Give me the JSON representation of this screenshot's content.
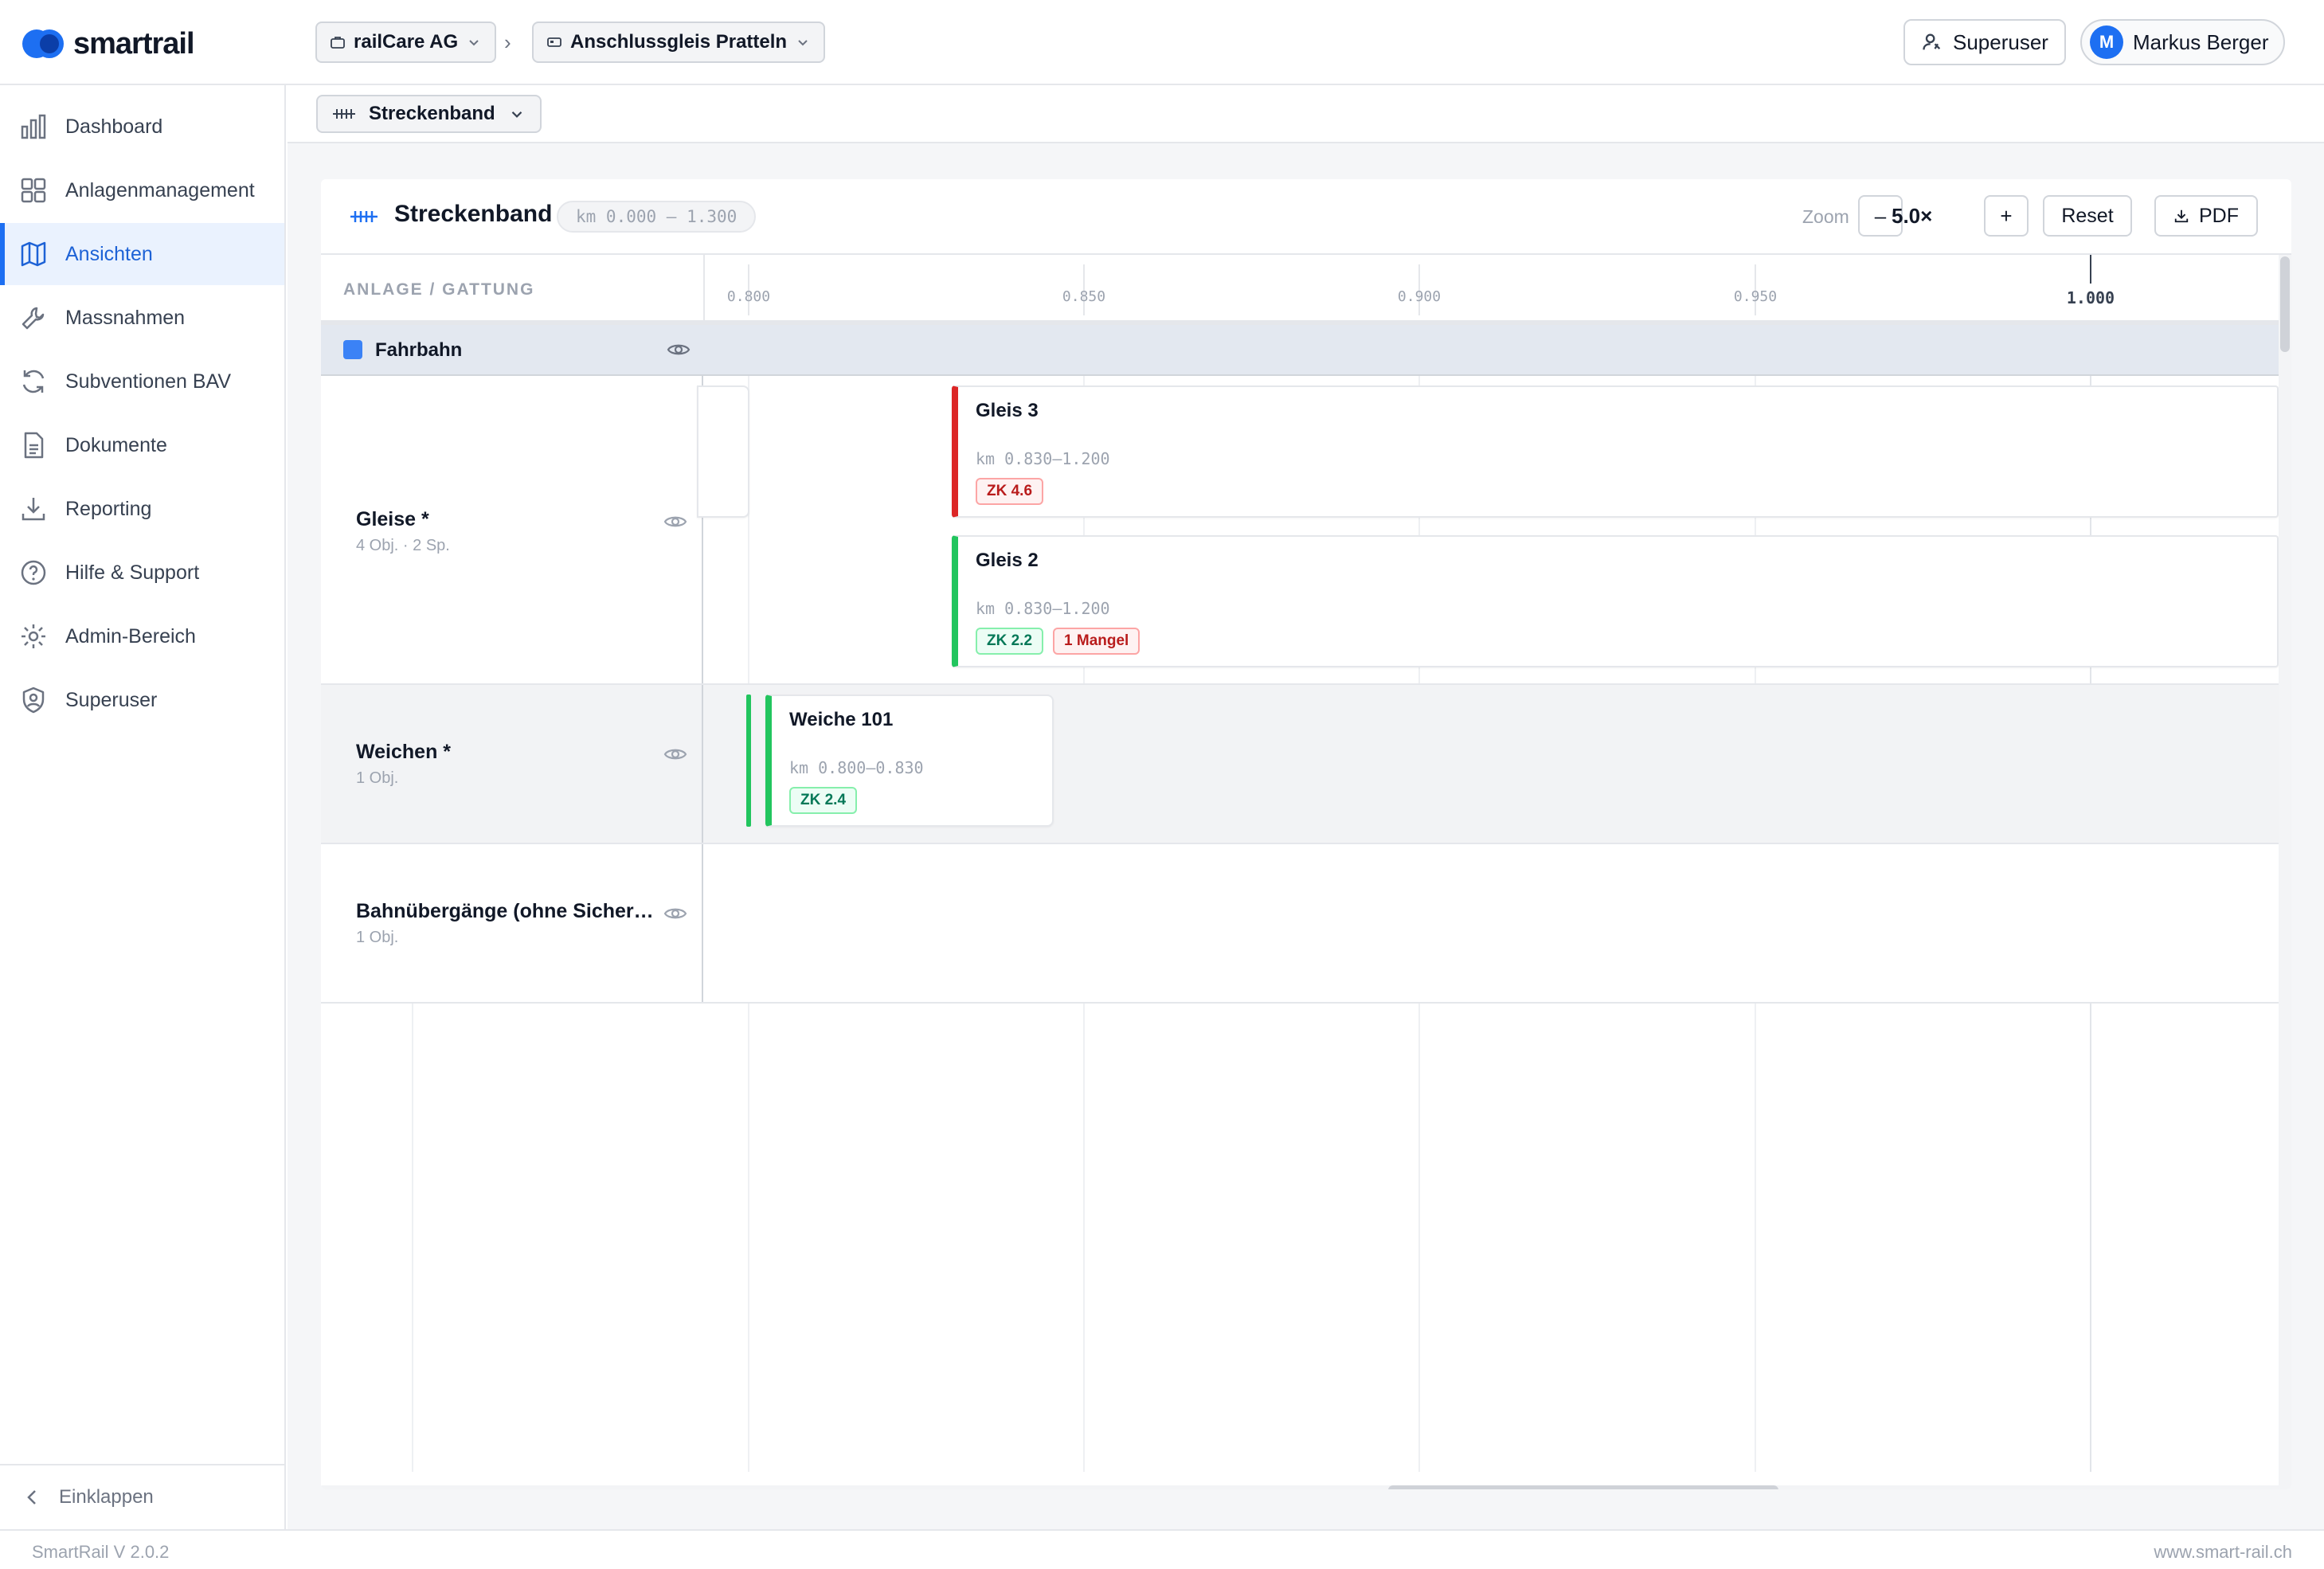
{
  "app": {
    "logo_text": "smartrail",
    "version": "SmartRail V 2.0.2",
    "website": "www.smart-rail.ch"
  },
  "header": {
    "org": "railCare AG",
    "site": "Anschlussgleis Pratteln",
    "role_button": "Superuser",
    "user": {
      "initial": "M",
      "name": "Markus Berger"
    }
  },
  "sidebar": {
    "items": [
      {
        "label": "Dashboard",
        "icon": "bar-chart-icon",
        "active": false
      },
      {
        "label": "Anlagenmanagement",
        "icon": "grid-icon",
        "active": false
      },
      {
        "label": "Ansichten",
        "icon": "map-icon",
        "active": true
      },
      {
        "label": "Massnahmen",
        "icon": "wrench-icon",
        "active": false
      },
      {
        "label": "Subventionen BAV",
        "icon": "refresh-icon",
        "active": false
      },
      {
        "label": "Dokumente",
        "icon": "document-icon",
        "active": false
      },
      {
        "label": "Reporting",
        "icon": "download-icon",
        "active": false
      },
      {
        "label": "Hilfe & Support",
        "icon": "help-circle-icon",
        "active": false
      },
      {
        "label": "Admin-Bereich",
        "icon": "gear-icon",
        "active": false
      },
      {
        "label": "Superuser",
        "icon": "shield-user-icon",
        "active": false
      }
    ],
    "collapse_label": "Einklappen"
  },
  "subheader": {
    "view": "Streckenband"
  },
  "panel": {
    "title": "Streckenband",
    "range": "km 0.000 – 1.300",
    "zoom_label": "Zoom",
    "zoom_minus": "–",
    "zoom_value": "5.0×",
    "zoom_plus": "+",
    "reset": "Reset",
    "pdf": "PDF"
  },
  "axis": {
    "header": "ANLAGE / GATTUNG",
    "ticks": [
      "0.800",
      "0.850",
      "0.900",
      "0.950",
      "1.000"
    ],
    "major_tick": "1.000"
  },
  "categories": [
    {
      "name": "Fahrbahn",
      "color": "#3b82f6"
    },
    {
      "name": "Gleise *",
      "sub": "4 Obj. · 2 Sp."
    },
    {
      "name": "Weichen *",
      "sub": "1 Obj."
    },
    {
      "name": "Bahnübergänge (ohne Sicher…",
      "sub": "1 Obj."
    }
  ],
  "objects": [
    {
      "title": "Gleis 3",
      "km": "km 0.830–1.200",
      "status_color": "#dc2626",
      "badges": [
        {
          "text": "ZK 4.6",
          "tone": "red"
        }
      ]
    },
    {
      "title": "Gleis 2",
      "km": "km 0.830–1.200",
      "status_color": "#22c55e",
      "badges": [
        {
          "text": "ZK 2.2",
          "tone": "green"
        },
        {
          "text": "1 Mangel",
          "tone": "red"
        }
      ]
    },
    {
      "title": "Weiche 101",
      "km": "km 0.800–0.830",
      "status_color": "#22c55e",
      "badges": [
        {
          "text": "ZK 2.4",
          "tone": "green"
        }
      ]
    }
  ]
}
